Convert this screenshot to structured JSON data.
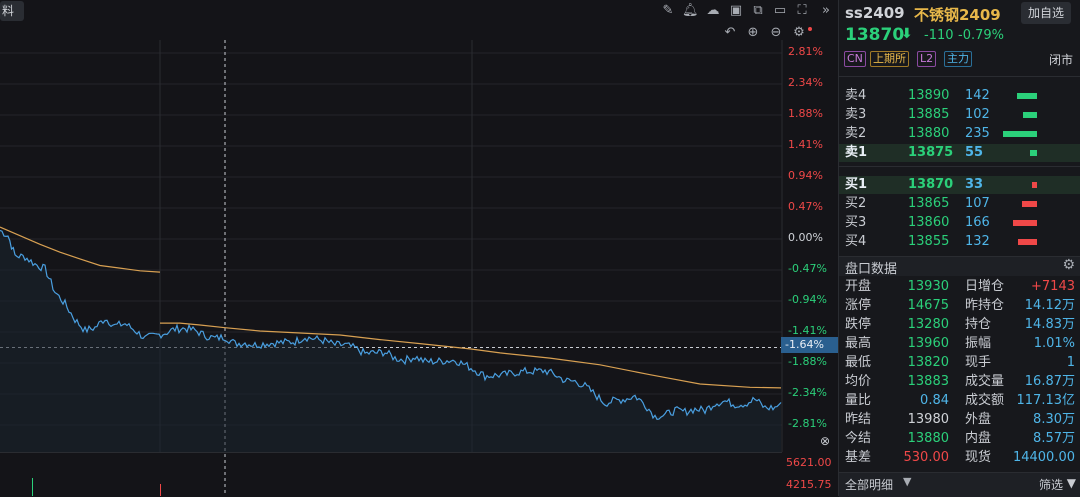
{
  "toolbar": {
    "tab_label": "料",
    "icons": [
      "edit-icon",
      "bell-icon",
      "cloud-icon",
      "screenshot-icon",
      "copy-icon",
      "monitor-icon",
      "fullscreen-icon",
      "collapse-icon"
    ]
  },
  "chart": {
    "pct_labels": [
      "2.81%",
      "2.34%",
      "1.88%",
      "1.41%",
      "0.94%",
      "0.47%",
      "0.00%",
      "-0.47%",
      "-0.94%",
      "-1.41%",
      "-1.88%",
      "-2.34%",
      "-2.81%"
    ],
    "crosshair_label": "-1.64%",
    "volume_labels": [
      "5621.00",
      "4215.75"
    ],
    "colors": {
      "up": "#f04848",
      "down": "#2bd07a",
      "neutral": "#d0d3d8",
      "price_line": "#4a9fe0",
      "avg_line": "#d8a052"
    }
  },
  "chart_data": {
    "type": "line",
    "ylim": [
      -2.81,
      2.81
    ],
    "ylabel_ticks": [
      "2.81%",
      "2.34%",
      "1.88%",
      "1.41%",
      "0.94%",
      "0.47%",
      "0.00%",
      "-0.47%",
      "-0.94%",
      "-1.41%",
      "-1.88%",
      "-2.34%",
      "-2.81%"
    ],
    "series": [
      {
        "key": "price",
        "points": [
          [
            0,
            0.13
          ],
          [
            8,
            0.05
          ],
          [
            15,
            -0.25
          ],
          [
            25,
            -0.27
          ],
          [
            35,
            -0.38
          ],
          [
            45,
            -0.45
          ],
          [
            55,
            -0.8
          ],
          [
            65,
            -0.98
          ],
          [
            75,
            -1.22
          ],
          [
            85,
            -1.38
          ],
          [
            95,
            -1.34
          ],
          [
            105,
            -1.2
          ],
          [
            115,
            -1.31
          ],
          [
            125,
            -1.28
          ],
          [
            135,
            -1.38
          ],
          [
            145,
            -1.5
          ],
          [
            155,
            -1.46
          ],
          [
            165,
            -1.42
          ],
          [
            175,
            -1.36
          ],
          [
            185,
            -1.35
          ],
          [
            195,
            -1.38
          ],
          [
            205,
            -1.46
          ],
          [
            215,
            -1.5
          ],
          [
            225,
            -1.48
          ],
          [
            235,
            -1.58
          ],
          [
            245,
            -1.57
          ],
          [
            255,
            -1.6
          ],
          [
            265,
            -1.58
          ],
          [
            275,
            -1.57
          ],
          [
            285,
            -1.56
          ],
          [
            295,
            -1.55
          ],
          [
            305,
            -1.48
          ],
          [
            315,
            -1.51
          ],
          [
            325,
            -1.54
          ],
          [
            335,
            -1.6
          ],
          [
            345,
            -1.6
          ],
          [
            355,
            -1.65
          ],
          [
            365,
            -1.73
          ],
          [
            375,
            -1.72
          ],
          [
            385,
            -1.71
          ],
          [
            395,
            -1.8
          ],
          [
            405,
            -1.83
          ],
          [
            415,
            -1.78
          ],
          [
            425,
            -1.85
          ],
          [
            435,
            -1.85
          ],
          [
            445,
            -1.84
          ],
          [
            455,
            -1.83
          ],
          [
            465,
            -1.9
          ],
          [
            475,
            -1.98
          ],
          [
            485,
            -2.07
          ],
          [
            495,
            -2.06
          ],
          [
            505,
            -2.05
          ],
          [
            515,
            -2.02
          ],
          [
            525,
            -2.0
          ],
          [
            535,
            -2.0
          ],
          [
            545,
            -1.99
          ],
          [
            555,
            -2.05
          ],
          [
            565,
            -2.14
          ],
          [
            575,
            -2.15
          ],
          [
            585,
            -2.22
          ],
          [
            595,
            -2.35
          ],
          [
            605,
            -2.48
          ],
          [
            615,
            -2.44
          ],
          [
            625,
            -2.42
          ],
          [
            635,
            -2.37
          ],
          [
            645,
            -2.5
          ],
          [
            655,
            -2.68
          ],
          [
            665,
            -2.66
          ],
          [
            675,
            -2.59
          ],
          [
            685,
            -2.61
          ],
          [
            695,
            -2.57
          ],
          [
            705,
            -2.59
          ],
          [
            715,
            -2.48
          ],
          [
            725,
            -2.45
          ],
          [
            735,
            -2.5
          ],
          [
            745,
            -2.49
          ],
          [
            755,
            -2.42
          ],
          [
            765,
            -2.55
          ],
          [
            775,
            -2.55
          ],
          [
            781,
            -2.47
          ]
        ]
      },
      {
        "key": "average",
        "points": [
          [
            0,
            0.18
          ],
          [
            20,
            0.05
          ],
          [
            40,
            -0.08
          ],
          [
            60,
            -0.2
          ],
          [
            80,
            -0.3
          ],
          [
            100,
            -0.4
          ],
          [
            120,
            -0.44
          ],
          [
            140,
            -0.48
          ],
          [
            160,
            -0.5
          ]
        ]
      },
      {
        "key": "average_cont",
        "points": [
          [
            160,
            -1.27
          ],
          [
            180,
            -1.27
          ],
          [
            200,
            -1.3
          ],
          [
            225,
            -1.34
          ],
          [
            260,
            -1.39
          ],
          [
            300,
            -1.42
          ],
          [
            340,
            -1.45
          ],
          [
            380,
            -1.52
          ],
          [
            420,
            -1.58
          ],
          [
            470,
            -1.66
          ],
          [
            500,
            -1.72
          ],
          [
            550,
            -1.8
          ],
          [
            600,
            -1.9
          ],
          [
            650,
            -2.05
          ],
          [
            700,
            -2.19
          ],
          [
            750,
            -2.24
          ],
          [
            781,
            -2.25
          ]
        ]
      }
    ]
  },
  "quote": {
    "code": "ss2409",
    "name": "不锈钢2409",
    "add_button": "加自选",
    "price": "13870",
    "change": "-110",
    "change_pct": "-0.79%",
    "tags": [
      "CN",
      "上期所",
      "L2",
      "主力"
    ],
    "status": "闭市"
  },
  "orderbook": {
    "asks": [
      {
        "label": "卖4",
        "price": "13890",
        "vol": "142",
        "bar": 0.58
      },
      {
        "label": "卖3",
        "price": "13885",
        "vol": "102",
        "bar": 0.42
      },
      {
        "label": "卖2",
        "price": "13880",
        "vol": "235",
        "bar": 1.0
      },
      {
        "label": "卖1",
        "price": "13875",
        "vol": "55",
        "bar": 0.22
      }
    ],
    "bids": [
      {
        "label": "买1",
        "price": "13870",
        "vol": "33",
        "bar": 0.14
      },
      {
        "label": "买2",
        "price": "13865",
        "vol": "107",
        "bar": 0.45
      },
      {
        "label": "买3",
        "price": "13860",
        "vol": "166",
        "bar": 0.7
      },
      {
        "label": "买4",
        "price": "13855",
        "vol": "132",
        "bar": 0.56
      }
    ]
  },
  "stats": {
    "title": "盘口数据",
    "rows": [
      {
        "l1": "开盘",
        "v1": "13930",
        "c1": "#2bd07a",
        "l2": "日增仓",
        "v2": "+7143",
        "c2": "#f04848"
      },
      {
        "l1": "涨停",
        "v1": "14675",
        "c1": "#2bd07a",
        "l2": "昨持仓",
        "v2": "14.12万",
        "c2": "#4fb5e8"
      },
      {
        "l1": "跌停",
        "v1": "13280",
        "c1": "#2bd07a",
        "l2": "持仓",
        "v2": "14.83万",
        "c2": "#4fb5e8"
      },
      {
        "l1": "最高",
        "v1": "13960",
        "c1": "#2bd07a",
        "l2": "振幅",
        "v2": "1.01%",
        "c2": "#4fb5e8"
      },
      {
        "l1": "最低",
        "v1": "13820",
        "c1": "#2bd07a",
        "l2": "现手",
        "v2": "1",
        "c2": "#4fb5e8"
      },
      {
        "l1": "均价",
        "v1": "13883",
        "c1": "#2bd07a",
        "l2": "成交量",
        "v2": "16.87万",
        "c2": "#4fb5e8"
      },
      {
        "l1": "量比",
        "v1": "0.84",
        "c1": "#4fb5e8",
        "l2": "成交额",
        "v2": "117.13亿",
        "c2": "#4fb5e8"
      },
      {
        "l1": "昨结",
        "v1": "13980",
        "c1": "#d0d3d8",
        "l2": "外盘",
        "v2": "8.30万",
        "c2": "#4fb5e8"
      },
      {
        "l1": "今结",
        "v1": "13880",
        "c1": "#2bd07a",
        "l2": "内盘",
        "v2": "8.57万",
        "c2": "#4fb5e8"
      },
      {
        "l1": "基差",
        "v1": "530.00",
        "c1": "#f04848",
        "l2": "现货",
        "v2": "14400.00",
        "c2": "#4fb5e8"
      }
    ],
    "footer_left": "全部明细",
    "footer_right": "筛选"
  }
}
